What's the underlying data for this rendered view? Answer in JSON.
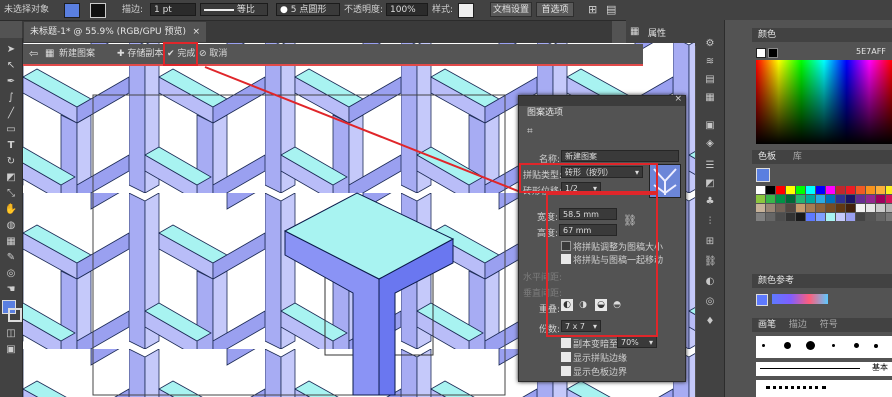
{
  "control_bar": {
    "selection_label": "未选择对象",
    "stroke_label": "描边:",
    "stroke_weight": "1 pt",
    "profile_label": "等比",
    "brush_label": "5 点圆形",
    "opacity_label": "不透明度:",
    "opacity_value": "100%",
    "style_label": "样式:",
    "doc_setup_button": "文档设置",
    "prefs_button": "首选项",
    "colors": {
      "fill": "#5a7fe0",
      "stroke": "#ffffff"
    }
  },
  "document_tab": {
    "title": "未标题-1* @ 55.9% (RGB/GPU 预览)",
    "close": "×"
  },
  "pattern_bar": {
    "back_arrow": "⇦",
    "pattern_name": "新建图案",
    "save_copy": "存储副本",
    "done": "完成",
    "cancel": "取消"
  },
  "properties_tab": "属性",
  "pattern_options": {
    "tab": "图案选项",
    "name_label": "名称:",
    "name_value": "新建图案",
    "tile_type_label": "拼贴类型:",
    "tile_type_value": "砖形（按列）",
    "brick_offset_label": "砖形位移:",
    "brick_offset_value": "1/2",
    "width_label": "宽度:",
    "width_value": "58.5 mm",
    "height_label": "高度:",
    "height_value": "67 mm",
    "fit_tile_label": "将拼贴调整为图稿大小",
    "move_tile_label": "将拼贴与图稿一起移动",
    "h_spacing_label": "水平间距:",
    "v_spacing_label": "垂直间距:",
    "overlap_label": "重叠:",
    "copies_label": "份数:",
    "copies_value": "7 x 7",
    "dim_copies_label": "副本变暗至:",
    "dim_copies_value": "70%",
    "show_tile_edge_label": "显示拼贴边缘",
    "show_swatch_bounds_label": "显示色板边界"
  },
  "right_panels": {
    "color_title": "颜色",
    "hex_value": "5E7AFF",
    "swatches_tab": "色板",
    "library_tab": "库",
    "color_guide_title": "颜色参考",
    "brushes_tab": "画笔",
    "symbols_tab": "描边",
    "symbols_tab2": "符号",
    "basic_label": "基本"
  },
  "icons": {
    "close": "×",
    "chevron": "▾",
    "check": "✔"
  }
}
